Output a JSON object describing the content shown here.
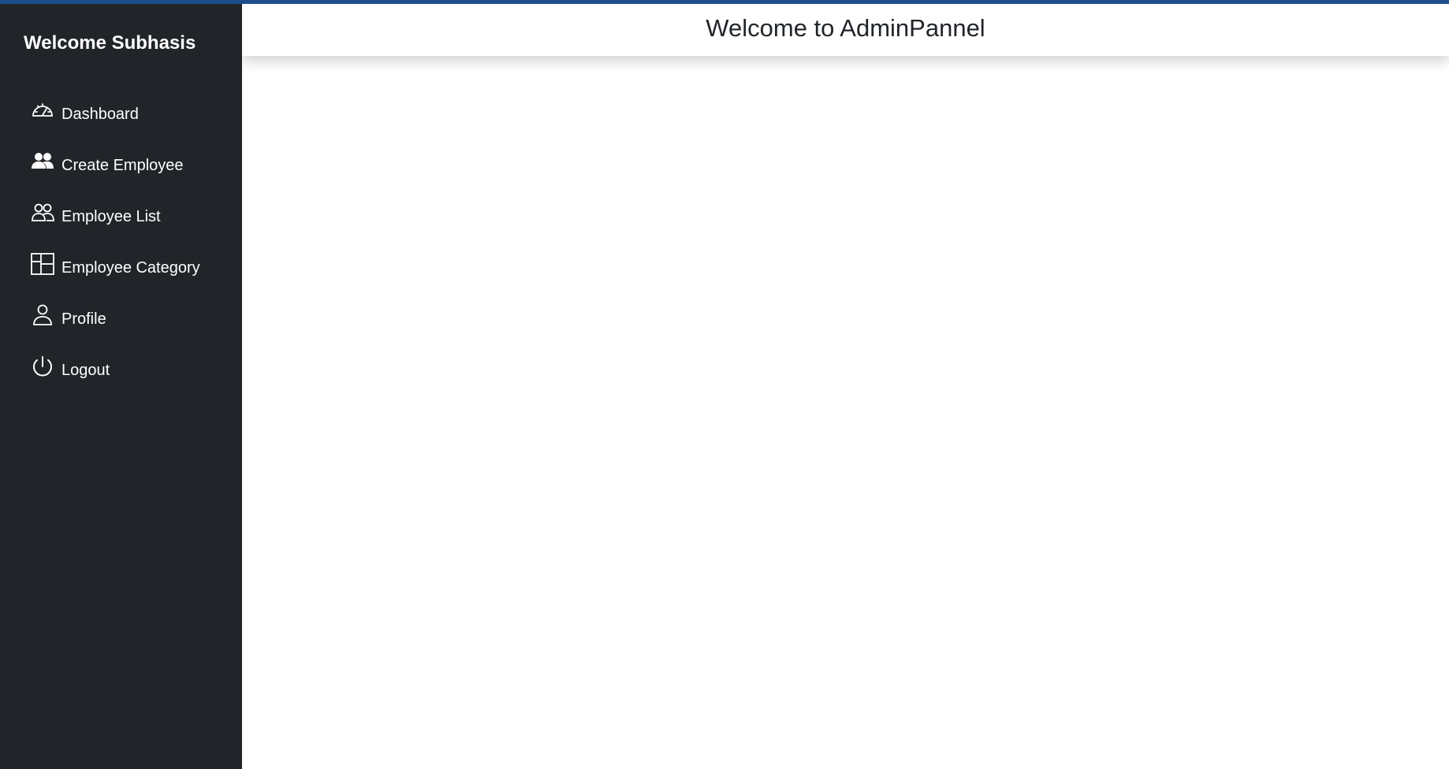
{
  "sidebar": {
    "brand": "Welcome Subhasis",
    "items": [
      {
        "label": "Dashboard",
        "icon": "speedometer-icon"
      },
      {
        "label": "Create Employee",
        "icon": "people-fill-icon"
      },
      {
        "label": "Employee List",
        "icon": "people-outline-icon"
      },
      {
        "label": "Employee Category",
        "icon": "layout-panels-icon"
      },
      {
        "label": "Profile",
        "icon": "person-icon"
      },
      {
        "label": "Logout",
        "icon": "power-icon"
      }
    ]
  },
  "header": {
    "title": "Welcome to AdminPannel"
  },
  "colors": {
    "sidebar_bg": "#212529",
    "top_stripe": "#1f4e8c",
    "header_text": "#212529"
  }
}
